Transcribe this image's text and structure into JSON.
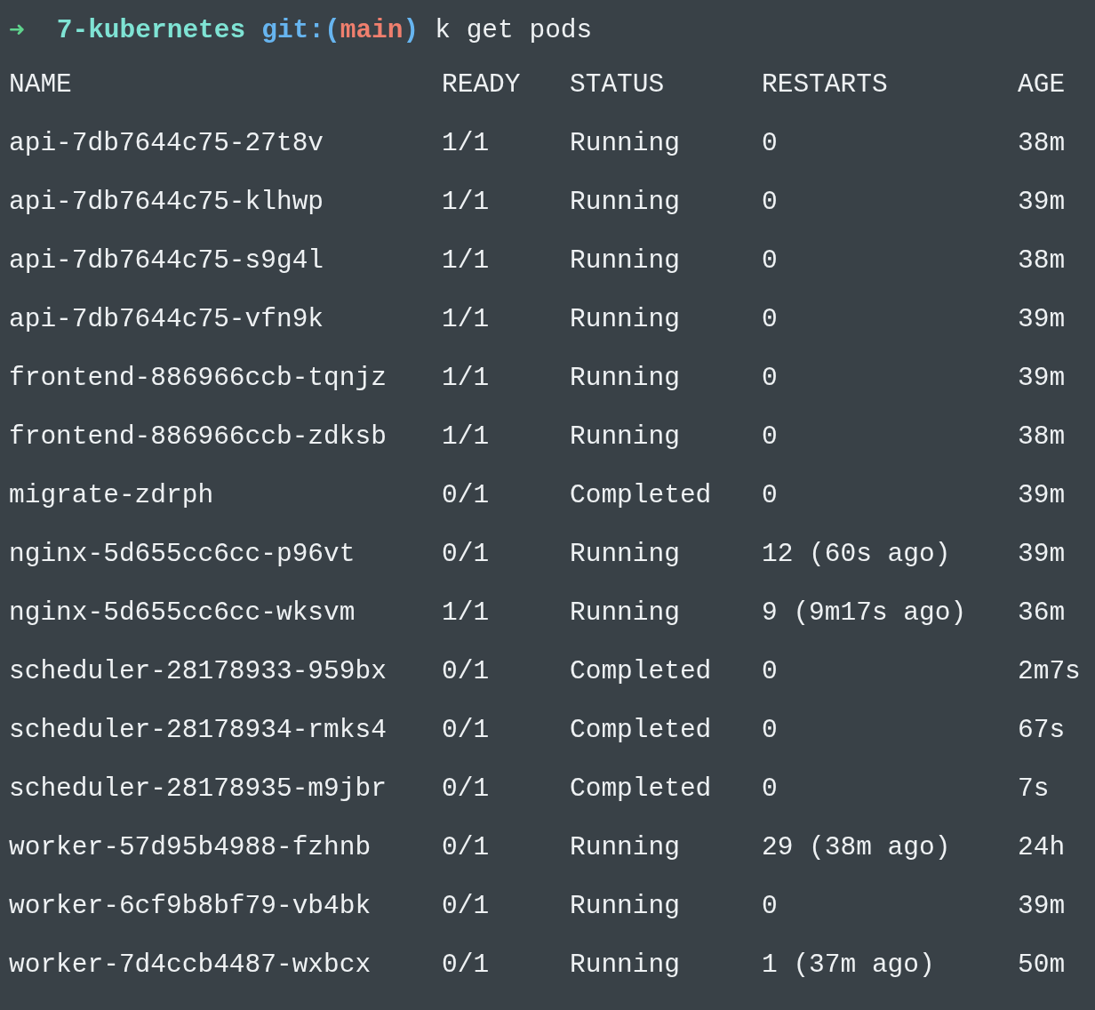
{
  "prompt": {
    "arrow": "➜",
    "directory": "7-kubernetes",
    "git_open": "git:(",
    "branch": "main",
    "git_close": ")",
    "command": "k get pods"
  },
  "columns": [
    "NAME",
    "READY",
    "STATUS",
    "RESTARTS",
    "AGE"
  ],
  "rows": [
    [
      "api-7db7644c75-27t8v",
      "1/1",
      "Running",
      "0",
      "38m"
    ],
    [
      "api-7db7644c75-klhwp",
      "1/1",
      "Running",
      "0",
      "39m"
    ],
    [
      "api-7db7644c75-s9g4l",
      "1/1",
      "Running",
      "0",
      "38m"
    ],
    [
      "api-7db7644c75-vfn9k",
      "1/1",
      "Running",
      "0",
      "39m"
    ],
    [
      "frontend-886966ccb-tqnjz",
      "1/1",
      "Running",
      "0",
      "39m"
    ],
    [
      "frontend-886966ccb-zdksb",
      "1/1",
      "Running",
      "0",
      "38m"
    ],
    [
      "migrate-zdrph",
      "0/1",
      "Completed",
      "0",
      "39m"
    ],
    [
      "nginx-5d655cc6cc-p96vt",
      "0/1",
      "Running",
      "12 (60s ago)",
      "39m"
    ],
    [
      "nginx-5d655cc6cc-wksvm",
      "1/1",
      "Running",
      "9 (9m17s ago)",
      "36m"
    ],
    [
      "scheduler-28178933-959bx",
      "0/1",
      "Completed",
      "0",
      "2m7s"
    ],
    [
      "scheduler-28178934-rmks4",
      "0/1",
      "Completed",
      "0",
      "67s"
    ],
    [
      "scheduler-28178935-m9jbr",
      "0/1",
      "Completed",
      "0",
      "7s"
    ],
    [
      "worker-57d95b4988-fzhnb",
      "0/1",
      "Running",
      "29 (38m ago)",
      "24h"
    ],
    [
      "worker-6cf9b8bf79-vb4bk",
      "0/1",
      "Running",
      "0",
      "39m"
    ],
    [
      "worker-7d4ccb4487-wxbcx",
      "0/1",
      "Running",
      "1 (37m ago)",
      "50m"
    ]
  ]
}
